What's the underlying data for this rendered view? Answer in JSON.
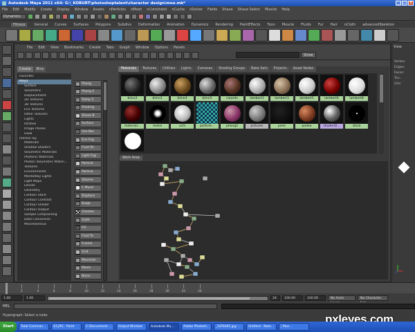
{
  "window": {
    "title": "Autodesk Maya 2011 x64: G:\\_KOBURT\\photoshoptalent\\character design\\moo.mb*"
  },
  "menubar": [
    "File",
    "Edit",
    "Modify",
    "Create",
    "Display",
    "Window",
    "Assets",
    "nParticles",
    "nMesh",
    "nConstraint",
    "nCache",
    "nSolver",
    "Fields",
    "Shave",
    "Shave Select",
    "Muscle",
    "Help"
  ],
  "status_line": {
    "mode": "Dynamics"
  },
  "shelf": {
    "tabs": [
      "Fitness",
      "General",
      "Curves",
      "Surfaces",
      "Polygons",
      "Subdivs",
      "Deformation",
      "Animation",
      "Dynamics",
      "Rendering",
      "PaintEffects",
      "Toon",
      "Muscle",
      "Fluids",
      "Fur",
      "Hair",
      "nCloth",
      "advancedSkeleton"
    ],
    "active_tab": "Fitness"
  },
  "hypershade": {
    "menus": [
      "File",
      "Edit",
      "View",
      "Bookmarks",
      "Create",
      "Tabs",
      "Graph",
      "Window",
      "Options",
      "Panels"
    ],
    "show_button": "Show",
    "left_tabs": [
      "Create",
      "Bins"
    ],
    "tree": [
      "Favorites",
      "Maya",
      "Surface",
      "Volumetric",
      "Displacement",
      "2D Textures",
      "3D Textures",
      "Env Textures",
      "Other Textures",
      "Lights",
      "Utilities",
      "Image Planes",
      "Glow",
      "mental ray",
      "Materials",
      "Shadow Shaders",
      "Volumetric Materials",
      "Photonic Materials",
      "Photon Volumetric Materi...",
      "Textures",
      "Environments",
      "MentalRay Lights",
      "Light Maps",
      "Lenses",
      "Geometry",
      "Contour Store",
      "Contour Contrast",
      "Contour Shader",
      "Contour Output",
      "Sample Compositing",
      "Data Conversion",
      "Miscellaneous"
    ],
    "nodes": [
      "Phong",
      "Phong E",
      "Ramp S",
      "Shading",
      "Shave B",
      "Surface",
      "Use Bac",
      "Env Fog",
      "Fluid Sh",
      "Light Fog",
      "Particle",
      "Particle",
      "Volume",
      "C Muscl",
      "Displace",
      "Bulge",
      "Checker",
      "Cloth",
      "Fill",
      "Fluid Te",
      "Fractal",
      "Grid",
      "Mountain",
      "Movie",
      "Noise"
    ],
    "material_tabs": [
      "Materials",
      "Textures",
      "Utilities",
      "Lights",
      "Cameras",
      "Shading Groups",
      "Bake Sets",
      "Projects",
      "Asset Nodes"
    ],
    "materials": [
      {
        "name": "blinn2",
        "tex": "dark"
      },
      {
        "name": "blinn3",
        "tex": "gray"
      },
      {
        "name": "blinn4",
        "tex": "brown"
      },
      {
        "name": "blinn5",
        "tex": "fur"
      },
      {
        "name": "carpets",
        "tex": "carpet"
      },
      {
        "name": "lambert1",
        "tex": "lightgray"
      },
      {
        "name": "lambert3",
        "tex": "grain"
      },
      {
        "name": "lambert5",
        "tex": "white"
      },
      {
        "name": "lambert6",
        "tex": "red"
      },
      {
        "name": "lambert8",
        "tex": "pale"
      },
      {
        "name": "material...",
        "tex": "crimson"
      },
      {
        "name": "metal",
        "tex": "spot"
      },
      {
        "name": "ochi",
        "tex": "eye"
      },
      {
        "name": "particle...",
        "tex": "checker"
      },
      {
        "name": "phong2",
        "tex": "violet"
      },
      {
        "name": "pictures",
        "tex": "pictures"
      },
      {
        "name": "piele",
        "tex": "speckle"
      },
      {
        "name": "podea",
        "tex": "wood"
      },
      {
        "name": "shaderGl...",
        "tex": "chrome"
      },
      {
        "name": "sticla",
        "tex": "dot"
      },
      {
        "name": "",
        "tex": "whiteball"
      }
    ],
    "work_area_tab": "Work Area"
  },
  "viewport_right": {
    "label": "View",
    "channels": [
      "Vertex:",
      "Edges:",
      "Faces:",
      "Tris:",
      "UVs:"
    ]
  },
  "timeline": {
    "ticks": [
      "2",
      "4",
      "6",
      "8",
      "10",
      "12",
      "14",
      "16",
      "18",
      "20",
      "22",
      "24"
    ],
    "range_start": "1.00",
    "range_start2": "1.00",
    "range_end": "24",
    "end_a": "100.00",
    "end_b": "100.00",
    "anim_layer": "No Anim Layer",
    "character_set": "No Character Set"
  },
  "command_line": {
    "label": "MEL"
  },
  "help_line": "Hypergraph: Select a node.",
  "taskbar": {
    "start": "Start",
    "tasks": [
      "Total Comman...",
      "43.JPG - Paint",
      "C:\\Documents ...",
      "Output Window",
      "Autodesk Ma...",
      "Adobe Photosh...",
      "_IGP0465.jpg -...",
      "Untitled - Note...",
      "| Mus..."
    ],
    "active_index": 4
  },
  "watermark": "pxleyes.com",
  "colors": {
    "title_blue": "#2a5fc8",
    "material_label": "#a9d39b",
    "selected_tree": "#5f7e98",
    "taskbar": "#2458c8"
  }
}
